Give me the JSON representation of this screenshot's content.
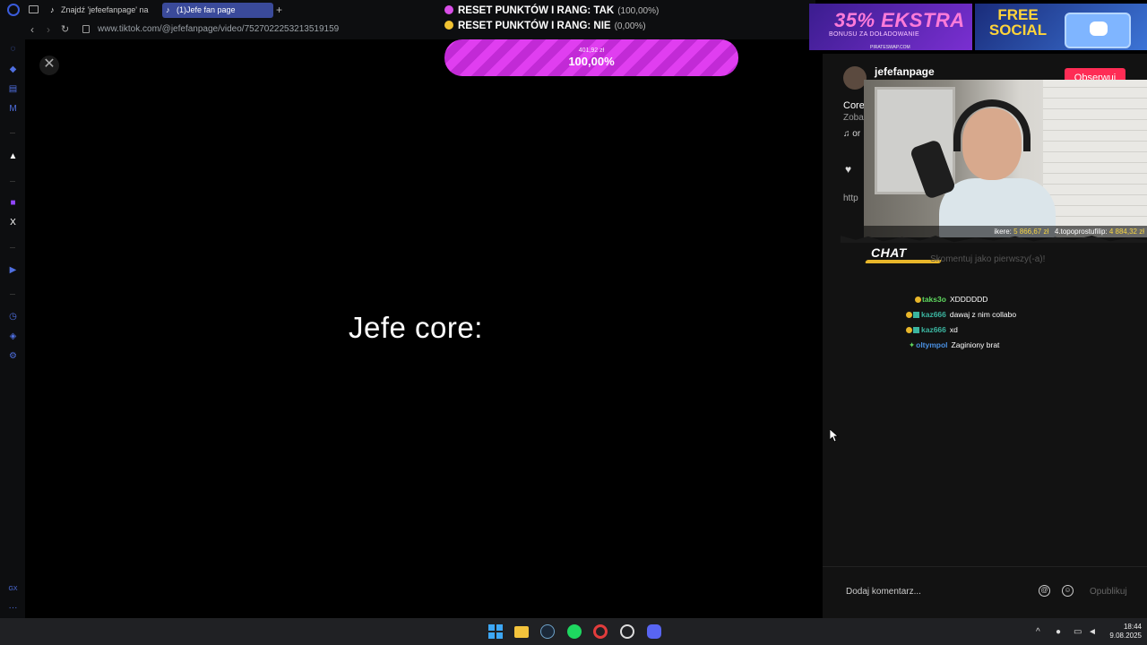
{
  "browser": {
    "tabs": [
      {
        "label": "Znajdź 'jefeefanpage' na",
        "active": false
      },
      {
        "label": "(1)Jefe fan page",
        "active": true
      }
    ],
    "new_tab": "+",
    "url": "www.tiktok.com/@jefefanpage/video/7527022253213519159"
  },
  "video": {
    "caption": "Jefe core:",
    "close_glyph": "✕"
  },
  "poll": {
    "options": [
      {
        "label": "RESET PUNKTÓW I RANG: TAK",
        "percent": "(100,00%)",
        "color": "#d94ee8"
      },
      {
        "label": "RESET PUNKTÓW I RANG: NIE",
        "percent": "(0,00%)",
        "color": "#f1c232"
      }
    ],
    "amount": "401,92 zł",
    "progress_label": "100,00%",
    "progress_fraction": 1.0
  },
  "post": {
    "author": "jefefanpage",
    "follow_label": "Obserwuj",
    "title_partial": "Core",
    "subtitle_partial": "Zoba",
    "music_partial": "♫  or",
    "link_partial": "http"
  },
  "ads": {
    "ad1": {
      "headline": "35% EKSTRA",
      "sub": "BONUSU ZA DOŁADOWANIE",
      "brand": "PIRATESWAP.COM"
    },
    "ad2": {
      "headline": "FREE SOCIAL"
    }
  },
  "webcam": {
    "ticker_name1": "ikere:",
    "ticker_amount1": "5 866,67 zł",
    "ticker_name2": "4.topoprostufilip:",
    "ticker_amount2": "4 884,32 zł"
  },
  "chat": {
    "logo": "CHAT",
    "placeholder": "Skomentuj jako pierwszy(-a)!",
    "messages": [
      {
        "user": "taks3o",
        "text": "XDDDDDD",
        "color": "#5fd85f"
      },
      {
        "user": "kaz666",
        "text": "dawaj z nim collabo",
        "color": "#3bb5a0"
      },
      {
        "user": "kaz666",
        "text": "xd",
        "color": "#3bb5a0"
      },
      {
        "user": "oltympol",
        "text": "Zaginiony brat",
        "color": "#4a90e2"
      }
    ]
  },
  "comment_box": {
    "placeholder": "Dodaj komentarz...",
    "post_label": "Opublikuj"
  },
  "clock": {
    "time": "18:44",
    "date": "9.08.2025"
  },
  "icons": {
    "heart": "♥",
    "at": "@",
    "emoji": "☺"
  }
}
